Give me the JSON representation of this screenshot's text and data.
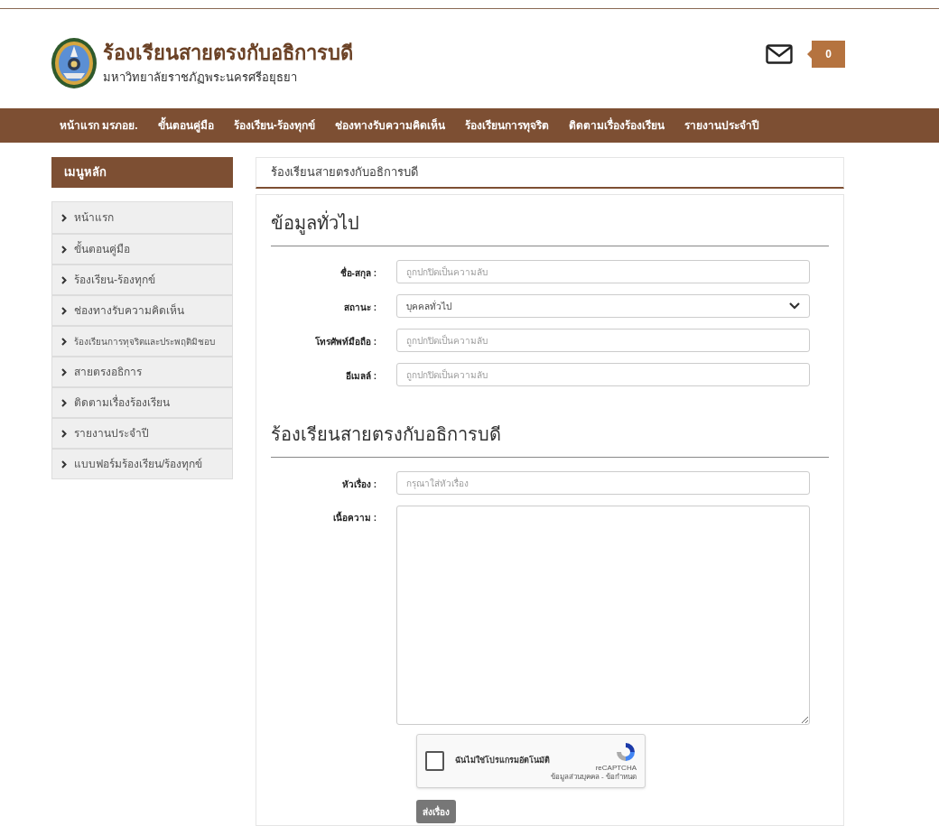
{
  "header": {
    "title": "ร้องเรียนสายตรงกับอธิการบดี",
    "subtitle": "มหาวิทยาลัยราชภัฏพระนครศรีอยุธยา",
    "message_count": "0"
  },
  "nav": [
    "หน้าแรก มรภอย.",
    "ขั้นตอนคู่มือ",
    "ร้องเรียน-ร้องทุกข์",
    "ช่องทางรับความคิดเห็น",
    "ร้องเรียนการทุจริต",
    "ติดตามเรื่องร้องเรียน",
    "รายงานประจำปี"
  ],
  "sidebar": {
    "title": "เมนูหลัก",
    "items": [
      {
        "label": "หน้าแรก",
        "small": false
      },
      {
        "label": "ขั้นตอนคู่มือ",
        "small": false
      },
      {
        "label": "ร้องเรียน-ร้องทุกข์",
        "small": false
      },
      {
        "label": "ช่องทางรับความคิดเห็น",
        "small": false
      },
      {
        "label": "ร้องเรียนการทุจริตและประพฤติมิชอบ",
        "small": true
      },
      {
        "label": "สายตรงอธิการ",
        "small": false
      },
      {
        "label": "ติดตามเรื่องร้องเรียน",
        "small": false
      },
      {
        "label": "รายงานประจำปี",
        "small": false
      },
      {
        "label": "แบบฟอร์มร้องเรียน/ร้องทุกข์",
        "small": false
      }
    ]
  },
  "breadcrumb": "ร้องเรียนสายตรงกับอธิการบดี",
  "sections": [
    {
      "heading": "ข้อมูลทั่วไป",
      "fields": [
        {
          "kind": "text",
          "label": "ชื่อ-สกุล :",
          "placeholder": "ถูกปกปิดเป็นความลับ"
        },
        {
          "kind": "select",
          "label": "สถานะ :",
          "value": "บุคคลทั่วไป"
        },
        {
          "kind": "text",
          "label": "โทรศัพท์มือถือ :",
          "placeholder": "ถูกปกปิดเป็นความลับ"
        },
        {
          "kind": "text",
          "label": "อีเมลล์ :",
          "placeholder": "ถูกปกปิดเป็นความลับ"
        }
      ]
    },
    {
      "heading": "ร้องเรียนสายตรงกับอธิการบดี",
      "fields": [
        {
          "kind": "text",
          "label": "หัวเรื่อง :",
          "placeholder": "กรุณาใส่หัวเรื่อง"
        },
        {
          "kind": "textarea",
          "label": "เนื้อความ :"
        }
      ]
    }
  ],
  "captcha": {
    "checked": false,
    "label": "ฉันไม่ใช่โปรแกรมอัตโนมัติ",
    "brand": "reCAPTCHA",
    "links": "ข้อมูลส่วนบุคคล - ข้อกำหนด"
  },
  "submit": "ส่งเรื่อง"
}
